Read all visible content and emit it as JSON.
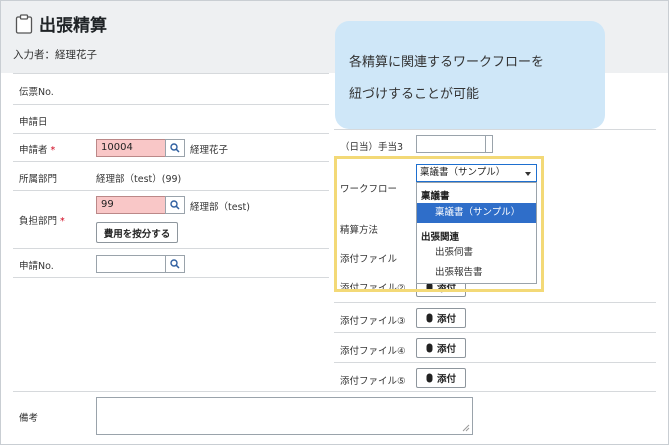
{
  "page": {
    "title": "出張精算",
    "entrant": "入力者：経理花子"
  },
  "left": {
    "voucher_no_label": "伝票No.",
    "request_date_label": "申請日",
    "applicant_label": "申請者",
    "applicant_code": "10004",
    "applicant_name": "経理花子",
    "department_label": "所属部門",
    "department_value": "経理部（test）(99)",
    "cost_dept_label": "負担部門",
    "cost_dept_code": "99",
    "cost_dept_name": "経理部（test)",
    "allocate_button": "費用を按分する",
    "request_no_label": "申請No.",
    "notes_label": "備考",
    "required_mark": "*"
  },
  "right": {
    "daily_allowance_label": "（日当）手当3",
    "workflow_label": "ワークフロー",
    "workflow_selected": "稟議書（サンプル）",
    "settlement_label": "精算方法",
    "attachment_1": "添付ファイル",
    "attachment_2": "添付ファイル②",
    "attachment_3": "添付ファイル③",
    "attachment_4": "添付ファイル④",
    "attachment_5": "添付ファイル⑤",
    "attach_button": "添付"
  },
  "dropdown": {
    "group1": "稟議書",
    "group1_items": [
      "稟議書（サンプル）"
    ],
    "group2": "出張関連",
    "group2_items": [
      "出張伺書",
      "出張報告書"
    ]
  },
  "callout": {
    "line1": "各精算に関連するワークフローを",
    "line2": "紐づけすることが可能"
  },
  "colors": {
    "highlight": "#f3d977",
    "callout_bg": "#cfe7f8",
    "selected_item": "#2f6ec9",
    "required": "#d0021b"
  }
}
